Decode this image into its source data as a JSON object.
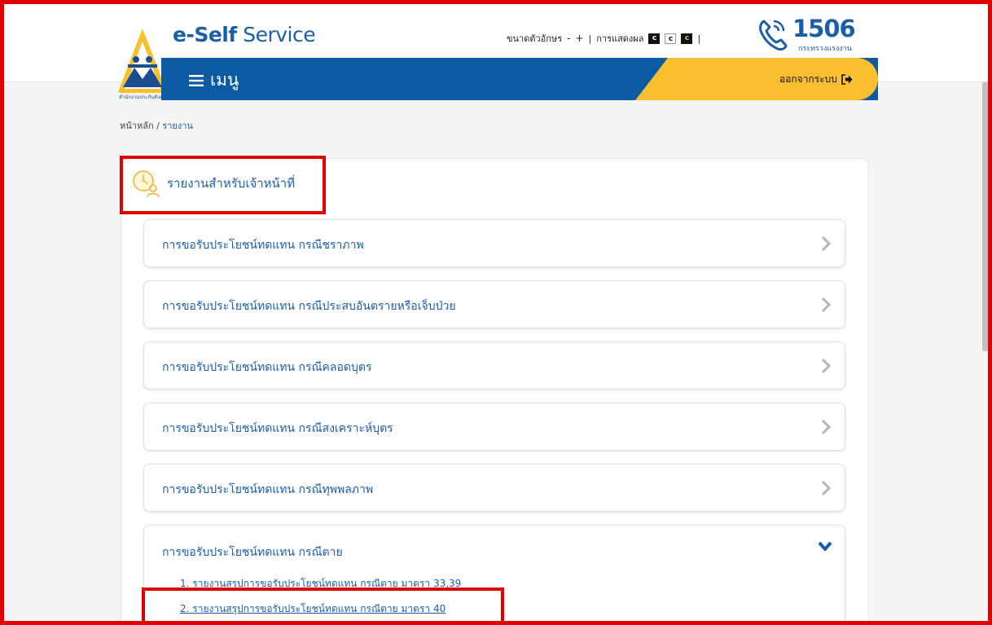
{
  "header": {
    "brand_bold": "e-Self",
    "brand_light": " Service",
    "logo_caption": "สำนักงานประกันสังคม",
    "font_size_label": "ขนาดตัวอักษร",
    "font_minus": "-",
    "font_plus": "+",
    "separator": "|",
    "display_label": "การแสดงผล",
    "contrast_options": [
      "c",
      "c",
      "c"
    ],
    "hotline_number": "1506",
    "hotline_sub": "กระทรวงแรงงาน"
  },
  "menu": {
    "label": "เมนู",
    "logout_label": "ออกจากระบบ"
  },
  "breadcrumb": {
    "home": "หน้าหลัก",
    "sep": " / ",
    "current": "รายงาน"
  },
  "card": {
    "title": "รายงานสำหรับเจ้าหน้าที่"
  },
  "accordions": [
    {
      "label": "การขอรับประโยชน์ทดแทน กรณีชราภาพ"
    },
    {
      "label": "การขอรับประโยชน์ทดแทน กรณีประสบอันตรายหรือเจ็บป่วย"
    },
    {
      "label": "การขอรับประโยชน์ทดแทน กรณีคลอดบุตร"
    },
    {
      "label": "การขอรับประโยชน์ทดแทน กรณีสงเคราะห์บุตร"
    },
    {
      "label": "การขอรับประโยชน์ทดแทน กรณีทุพพลภาพ"
    }
  ],
  "open_accordion": {
    "label": "การขอรับประโยชน์ทดแทน กรณีตาย",
    "links": [
      "1. รายงานสรุปการขอรับประโยชน์ทดแทน กรณีตาย มาตรา 33,39",
      "2. รายงานสรุปการขอรับประโยชน์ทดแทน กรณีตาย มาตรา 40"
    ]
  },
  "colors": {
    "primary_blue": "#0c5aa4",
    "accent_yellow": "#f9bf2e",
    "highlight_red": "#e30000"
  }
}
